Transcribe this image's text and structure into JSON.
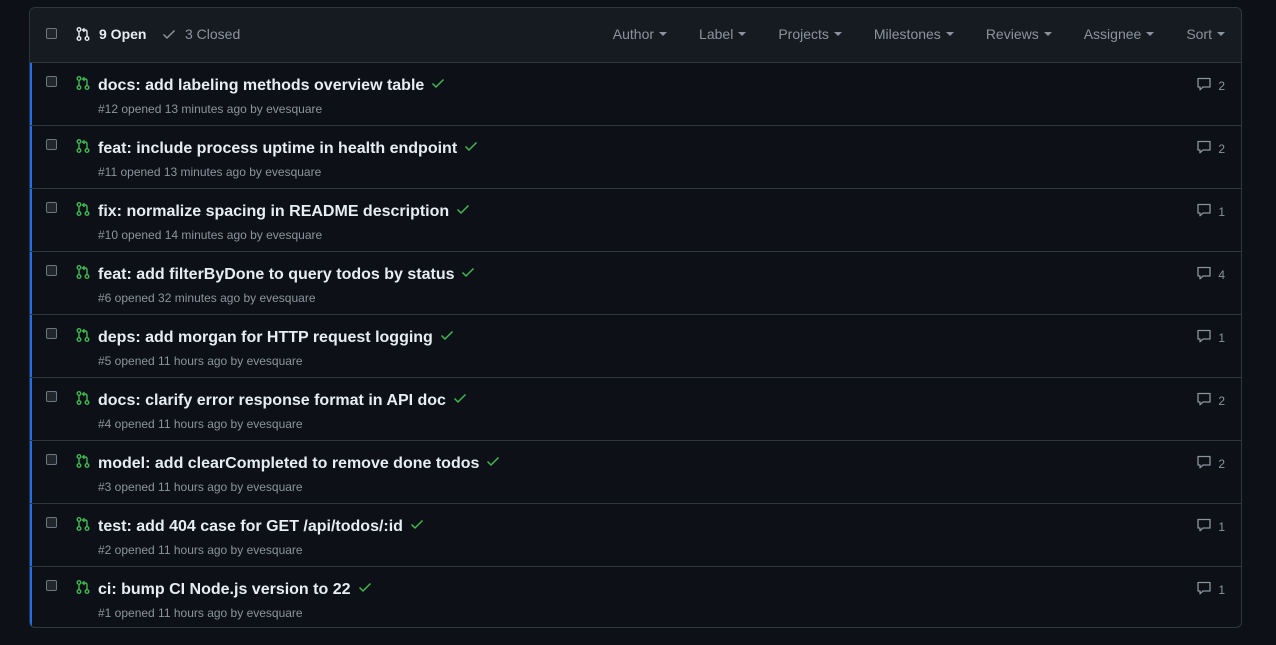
{
  "header": {
    "open_label": "9 Open",
    "closed_label": "3 Closed",
    "filters": [
      "Author",
      "Label",
      "Projects",
      "Milestones",
      "Reviews",
      "Assignee",
      "Sort"
    ]
  },
  "pulls": [
    {
      "title": "docs: add labeling methods overview table",
      "meta": "#12 opened 13 minutes ago by evesquare",
      "comments": "2"
    },
    {
      "title": "feat: include process uptime in health endpoint",
      "meta": "#11 opened 13 minutes ago by evesquare",
      "comments": "2"
    },
    {
      "title": "fix: normalize spacing in README description",
      "meta": "#10 opened 14 minutes ago by evesquare",
      "comments": "1"
    },
    {
      "title": "feat: add filterByDone to query todos by status",
      "meta": "#6 opened 32 minutes ago by evesquare",
      "comments": "4"
    },
    {
      "title": "deps: add morgan for HTTP request logging",
      "meta": "#5 opened 11 hours ago by evesquare",
      "comments": "1"
    },
    {
      "title": "docs: clarify error response format in API doc",
      "meta": "#4 opened 11 hours ago by evesquare",
      "comments": "2"
    },
    {
      "title": "model: add clearCompleted to remove done todos",
      "meta": "#3 opened 11 hours ago by evesquare",
      "comments": "2"
    },
    {
      "title": "test: add 404 case for GET /api/todos/:id",
      "meta": "#2 opened 11 hours ago by evesquare",
      "comments": "1"
    },
    {
      "title": "ci: bump CI Node.js version to 22",
      "meta": "#1 opened 11 hours ago by evesquare",
      "comments": "1"
    }
  ],
  "colors": {
    "open_green": "#3fb950",
    "accent_blue": "#1f6feb"
  }
}
